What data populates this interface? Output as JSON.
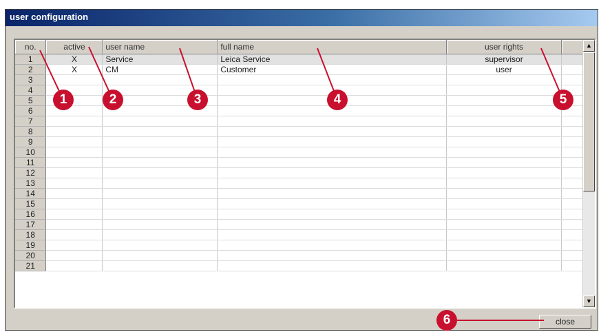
{
  "window": {
    "title": "user configuration"
  },
  "grid": {
    "columns": [
      "no.",
      "active",
      "user name",
      "full name",
      "user rights"
    ],
    "rows": [
      {
        "no": "1",
        "active": "X",
        "user_name": "Service",
        "full_name": "Leica Service",
        "user_rights": "supervisor"
      },
      {
        "no": "2",
        "active": "X",
        "user_name": "CM",
        "full_name": "Customer",
        "user_rights": "user"
      },
      {
        "no": "3",
        "active": "",
        "user_name": "",
        "full_name": "",
        "user_rights": ""
      },
      {
        "no": "4",
        "active": "",
        "user_name": "",
        "full_name": "",
        "user_rights": ""
      },
      {
        "no": "5",
        "active": "",
        "user_name": "",
        "full_name": "",
        "user_rights": ""
      },
      {
        "no": "6",
        "active": "",
        "user_name": "",
        "full_name": "",
        "user_rights": ""
      },
      {
        "no": "7",
        "active": "",
        "user_name": "",
        "full_name": "",
        "user_rights": ""
      },
      {
        "no": "8",
        "active": "",
        "user_name": "",
        "full_name": "",
        "user_rights": ""
      },
      {
        "no": "9",
        "active": "",
        "user_name": "",
        "full_name": "",
        "user_rights": ""
      },
      {
        "no": "10",
        "active": "",
        "user_name": "",
        "full_name": "",
        "user_rights": ""
      },
      {
        "no": "11",
        "active": "",
        "user_name": "",
        "full_name": "",
        "user_rights": ""
      },
      {
        "no": "12",
        "active": "",
        "user_name": "",
        "full_name": "",
        "user_rights": ""
      },
      {
        "no": "13",
        "active": "",
        "user_name": "",
        "full_name": "",
        "user_rights": ""
      },
      {
        "no": "14",
        "active": "",
        "user_name": "",
        "full_name": "",
        "user_rights": ""
      },
      {
        "no": "15",
        "active": "",
        "user_name": "",
        "full_name": "",
        "user_rights": ""
      },
      {
        "no": "16",
        "active": "",
        "user_name": "",
        "full_name": "",
        "user_rights": ""
      },
      {
        "no": "17",
        "active": "",
        "user_name": "",
        "full_name": "",
        "user_rights": ""
      },
      {
        "no": "18",
        "active": "",
        "user_name": "",
        "full_name": "",
        "user_rights": ""
      },
      {
        "no": "19",
        "active": "",
        "user_name": "",
        "full_name": "",
        "user_rights": ""
      },
      {
        "no": "20",
        "active": "",
        "user_name": "",
        "full_name": "",
        "user_rights": ""
      },
      {
        "no": "21",
        "active": "",
        "user_name": "",
        "full_name": "",
        "user_rights": ""
      }
    ]
  },
  "scrollbar": {
    "up_icon": "scroll-up-arrow-icon",
    "down_icon": "scroll-down-arrow-icon"
  },
  "buttons": {
    "close_label": "close"
  },
  "callouts": [
    "1",
    "2",
    "3",
    "4",
    "5",
    "6"
  ],
  "colors": {
    "callout": "#c8102e",
    "titlebar_start": "#0a246a",
    "titlebar_end": "#a6caf0",
    "window_face": "#d4d0c8"
  }
}
